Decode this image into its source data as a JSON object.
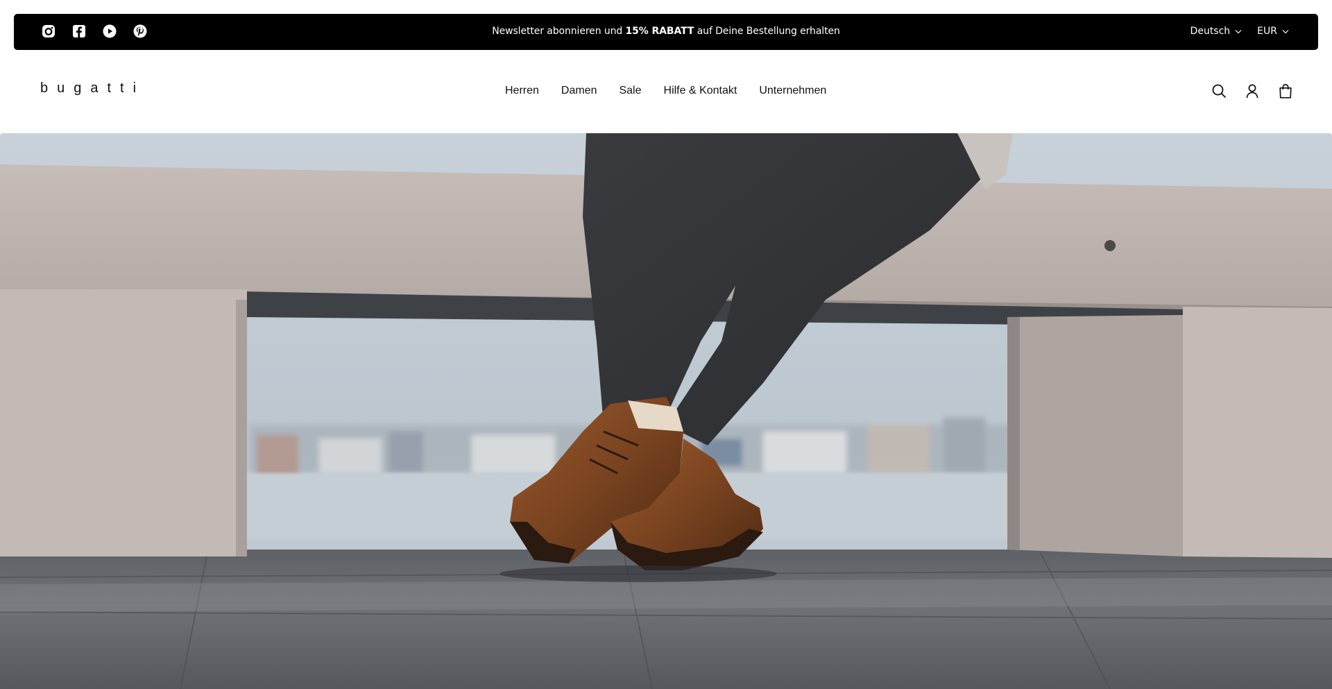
{
  "announcement": {
    "social_icons": [
      "instagram-icon",
      "facebook-icon",
      "youtube-icon",
      "pinterest-icon"
    ],
    "message_before": "Newsletter abonnieren und ",
    "message_bold": "15% RABATT",
    "message_after": " auf Deine Bestellung erhalten",
    "language": "Deutsch",
    "currency": "EUR"
  },
  "header": {
    "logo": "bugatti",
    "nav": [
      "Herren",
      "Damen",
      "Sale",
      "Hilfe & Kontakt",
      "Unternehmen"
    ],
    "icons": [
      "search-icon",
      "account-icon",
      "cart-icon"
    ]
  },
  "hero": {
    "image": "brown leather boots crossed under a stone bench by the harbour"
  },
  "colors": {
    "announcement_bg": "#000000",
    "text": "#111111",
    "background": "#ffffff"
  }
}
